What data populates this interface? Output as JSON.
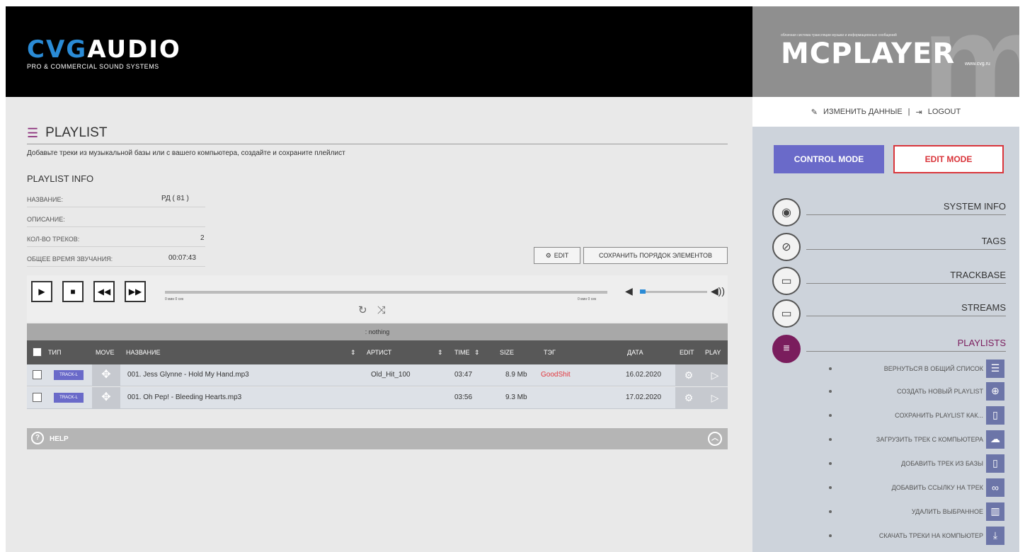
{
  "brand": {
    "logo_prefix": "CVG",
    "logo_suffix": "AUDIO",
    "logo_sub": "PRO & COMMERCIAL SOUND SYSTEMS",
    "mc_tagline": "облачная система трансляции музыки и информационных сообщений",
    "mc_logo": "MCPLAYER",
    "mc_url": "www.cvg.ru"
  },
  "userbar": {
    "edit_profile": "ИЗМЕНИТЬ ДАННЫЕ",
    "separator": "|",
    "logout": "LOGOUT"
  },
  "modes": {
    "control": "CONTROL MODE",
    "edit": "EDIT MODE"
  },
  "nav": [
    {
      "label": "SYSTEM INFO",
      "icon": "eye-icon"
    },
    {
      "label": "TAGS",
      "icon": "tag-icon"
    },
    {
      "label": "TRACKBASE",
      "icon": "file-audio-icon"
    },
    {
      "label": "STREAMS",
      "icon": "file-stream-icon"
    },
    {
      "label": "PLAYLISTS",
      "icon": "list-icon",
      "active": true
    }
  ],
  "sub_actions": [
    {
      "label": "ВЕРНУТЬСЯ В ОБЩИЙ СПИСОК",
      "icon": "list-icon"
    },
    {
      "label": "СОЗДАТЬ НОВЫЙ PLAYLIST",
      "icon": "plus-circle-icon"
    },
    {
      "label": "СОХРАНИТЬ PLAYLIST КАК...",
      "icon": "save-file-icon"
    },
    {
      "label": "ЗАГРУЗИТЬ ТРЕК С КОМПЬЮТЕРА",
      "icon": "cloud-upload-icon"
    },
    {
      "label": "ДОБАВИТЬ ТРЕК ИЗ БАЗЫ",
      "icon": "file-add-icon"
    },
    {
      "label": "ДОБАВИТЬ ССЫЛКУ НА ТРЕК",
      "icon": "link-icon"
    },
    {
      "label": "УДАЛИТЬ ВЫБРАННОЕ",
      "icon": "trash-icon"
    },
    {
      "label": "СКАЧАТЬ ТРЕКИ НА КОМПЬЮТЕР",
      "icon": "download-icon"
    }
  ],
  "page": {
    "title": "PLAYLIST",
    "subtitle": "Добавьте треки из музыкальной базы или с вашего компьютера, создайте и сохраните плейлист",
    "info_heading": "PLAYLIST INFO",
    "info": {
      "name_label": "НАЗВАНИЕ:",
      "name_value": "РД ( 81 )",
      "desc_label": "ОПИСАНИЕ:",
      "desc_value": "",
      "count_label": "КОЛ-ВО ТРЕКОВ:",
      "count_value": "2",
      "duration_label": "ОБЩЕЕ ВРЕМЯ ЗВУЧАНИЯ:",
      "duration_value": "00:07:43"
    },
    "edit_button": "EDIT",
    "save_order_button": "СОХРАНИТЬ ПОРЯДОК ЭЛЕМЕНТОВ"
  },
  "player": {
    "time_elapsed": "0 мин 0 сек",
    "time_total": "0 мин 0 сек",
    "now_playing": ": nothing",
    "volume_level": 0.08
  },
  "table": {
    "headers": {
      "type": "ТИП",
      "move": "MOVE",
      "name": "НАЗВАНИЕ",
      "artist": "АРТИСТ",
      "time": "TIME",
      "size": "SIZE",
      "tag": "ТЭГ",
      "date": "ДАТА",
      "edit": "EDIT",
      "play": "PLAY"
    },
    "rows": [
      {
        "type": "TRACK-L",
        "name": "001. Jess Glynne - Hold My Hand.mp3",
        "artist": "Old_Hit_100",
        "time": "03:47",
        "size": "8.9 Mb",
        "tag": "GoodShit",
        "date": "16.02.2020"
      },
      {
        "type": "TRACK-L",
        "name": "001. Oh Pep! - Bleeding Hearts.mp3",
        "artist": "",
        "time": "03:56",
        "size": "9.3 Mb",
        "tag": "",
        "date": "17.02.2020"
      }
    ]
  },
  "help": {
    "label": "HELP"
  },
  "colors": {
    "accent": "#6a6ac9",
    "active_nav": "#7a1d5d",
    "edit_red": "#d9353b",
    "tag_red": "#e2373d",
    "volume_blue": "#2a8bd6"
  }
}
